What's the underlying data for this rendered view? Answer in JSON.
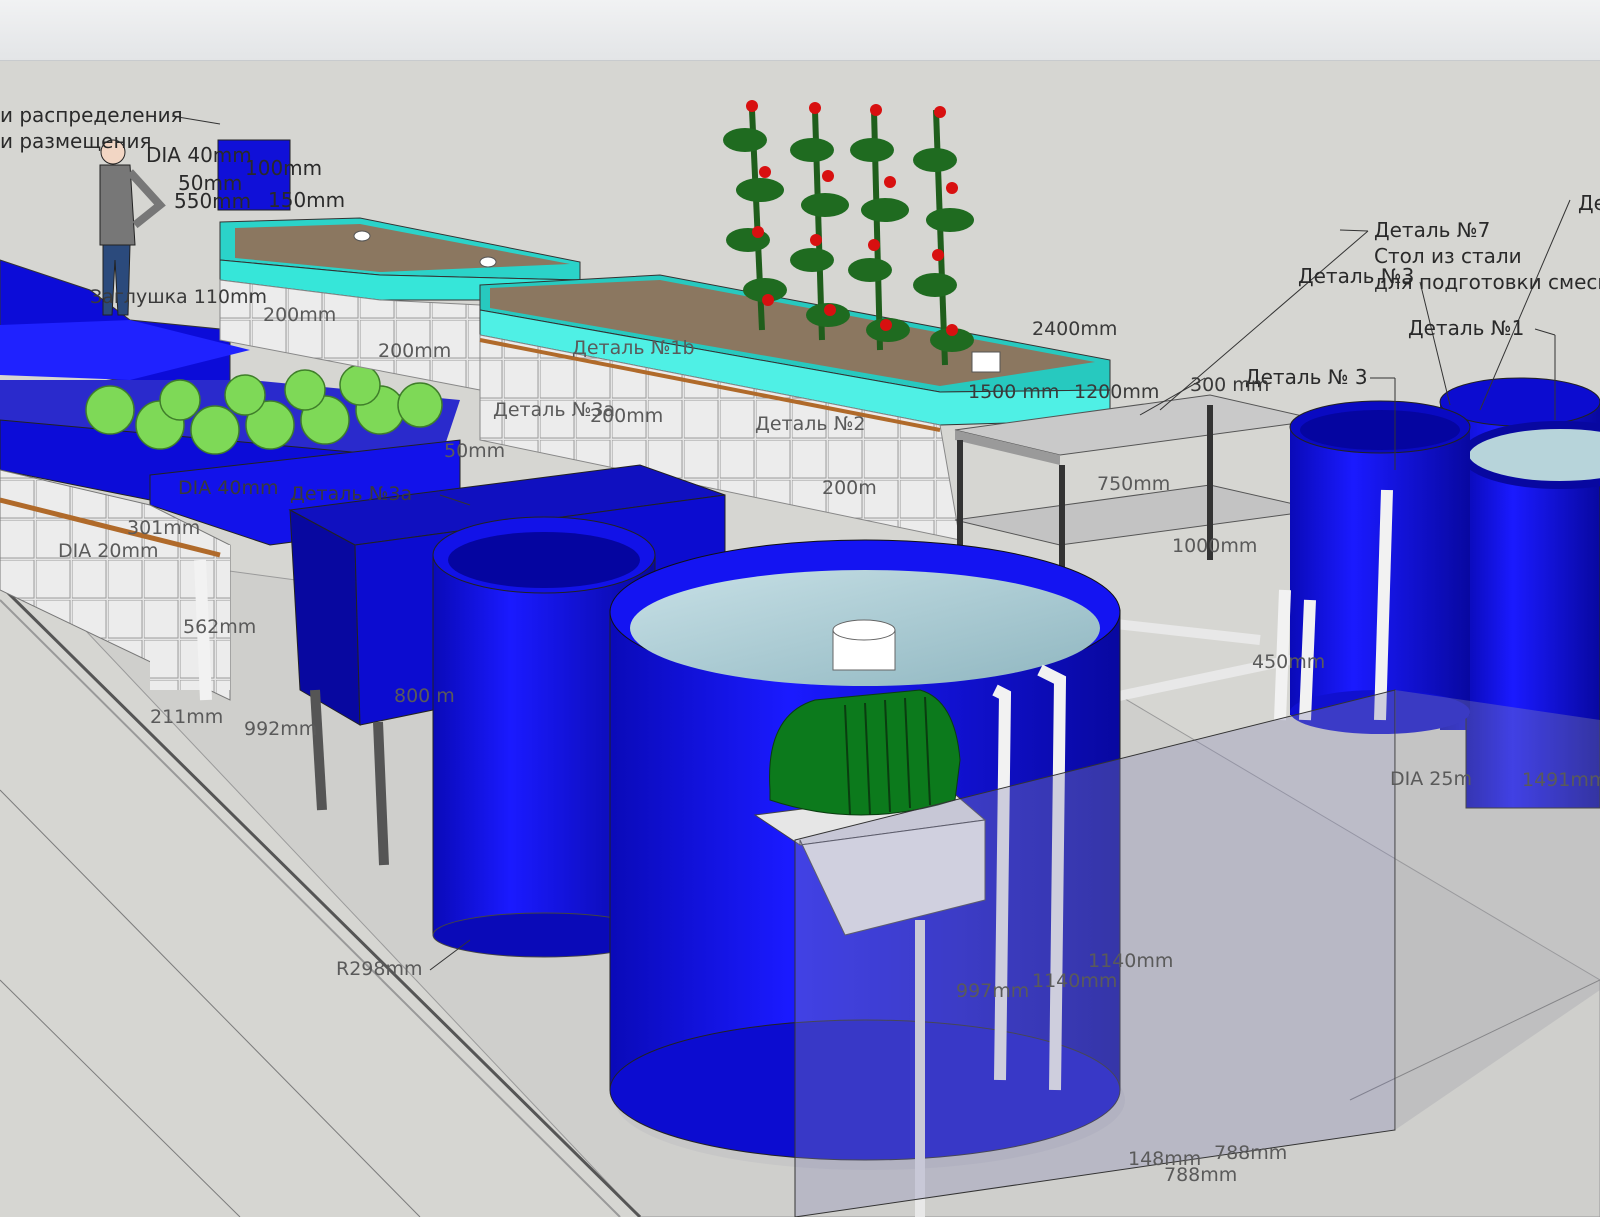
{
  "callouts": {
    "distribution_line1": "и распределения",
    "distribution_line2": "и размещения",
    "detail_7_line1": "Деталь №7",
    "detail_7_line2": "Стол из стали",
    "detail_7_line3": "для подготовки смеси",
    "detail_3_top": "Деталь №3",
    "detail_1": "Деталь №1",
    "detail_3": "Деталь № 3",
    "detail_1b": "Деталь №1b",
    "detail_3a": "Деталь №3a",
    "detail_2": "Деталь №2",
    "detail_3a_low": "Деталь №3a",
    "detail_edge": "Де",
    "plug": "Заглушка 110mm"
  },
  "dimensions": {
    "dia40_top": "DIA 40mm",
    "d100": "100mm",
    "d50": "50mm",
    "d550": "550mm",
    "d150": "150mm",
    "d2400": "2400mm",
    "d1500": "1500 mm",
    "d1200": "1200mm",
    "d300": "300 mm",
    "d200a": "200mm",
    "d200b": "200mm",
    "d50b": "50mm",
    "d200c": "200mm",
    "d200d": "200m",
    "d750": "750mm",
    "d1000": "1000mm",
    "d301": "301mm",
    "dia40_mid": "DIA 40mm",
    "dia20": "DIA 20mm",
    "d562": "562mm",
    "d211": "211mm",
    "d992": "992mm",
    "d800": "800 m",
    "r298": "R298mm",
    "d997": "997mm",
    "d1140a": "1140mm",
    "d1140b": "1140mm",
    "d450": "450mm",
    "dia25": "DIA 25m",
    "d1491": "1491mm",
    "d148": "148mm",
    "d788a": "788mm",
    "d788b": "788mm"
  },
  "colors": {
    "tank_blue": "#1010e6",
    "tank_dark": "#0808a8",
    "water": "#a9c8cf",
    "bed_cyan": "#3ee3d8",
    "soil": "#8b7760",
    "block": "#e6e6e6",
    "pump_green": "#0c7a1c",
    "tomato_red": "#d81010",
    "leaf_green": "#1f5e1c"
  }
}
